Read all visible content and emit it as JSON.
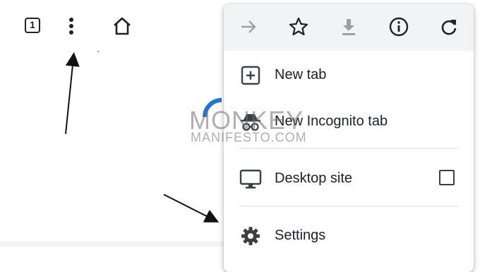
{
  "browser_toolbar": {
    "tab_count": "1",
    "icons": [
      "tab-switcher-icon",
      "more-options-icon",
      "home-icon"
    ]
  },
  "watermark": {
    "line1": "MONKEY",
    "line2": "MANIFESTO.COM"
  },
  "menu": {
    "toolbar_icons": [
      "forward-icon",
      "bookmark-star-icon",
      "download-icon",
      "info-icon",
      "reload-icon"
    ],
    "items": [
      {
        "label": "New tab",
        "icon": "new-tab-icon"
      },
      {
        "label": "New Incognito tab",
        "icon": "incognito-icon"
      },
      {
        "label": "Desktop site",
        "icon": "desktop-icon",
        "checked": false
      },
      {
        "label": "Settings",
        "icon": "settings-gear-icon"
      }
    ]
  },
  "colors": {
    "menu_toolbar_bg": "#f1f3f4",
    "spinner_blue": "#1a73e8",
    "text": "#202124"
  }
}
